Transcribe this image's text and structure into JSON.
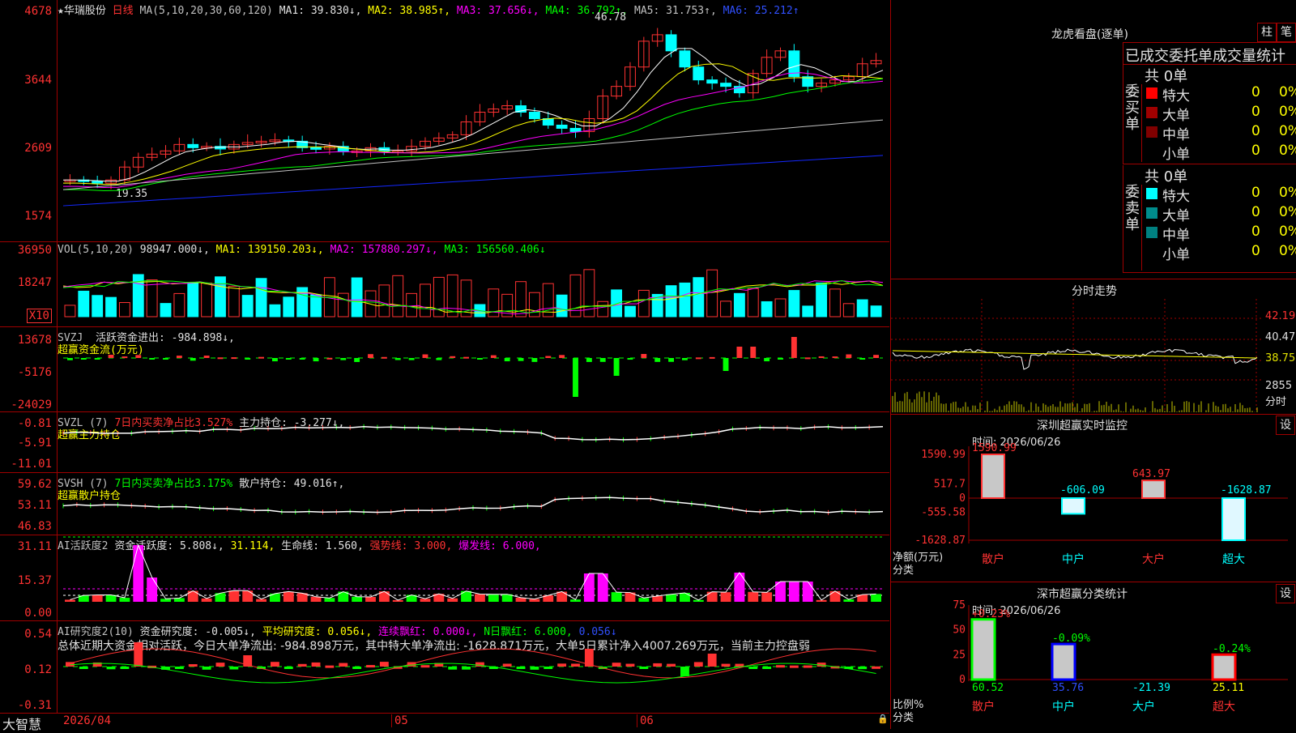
{
  "colors": {
    "up": "#ff3232",
    "down": "#00ffff",
    "ma1": "#ffffff",
    "ma2": "#ffff00",
    "ma3": "#ff00ff",
    "ma4": "#00ff00",
    "ma5": "#c0c0c0",
    "ma6": "#1428ff",
    "frame": "#a00000"
  },
  "price": {
    "yticks": [
      "4678",
      "3644",
      "2609",
      "1574"
    ],
    "star": "★",
    "stock": "华瑞股份",
    "period": "日线",
    "ma_label": "MA(5,10,20,30,60,120)",
    "ma1": "MA1: 39.830↓,",
    "ma2": "MA2: 38.985↑,",
    "ma3": "MA3: 37.656↓,",
    "ma4": "MA4: 36.792↑,",
    "ma5": "MA5: 31.753↑,",
    "ma6": "MA6: 25.212↑",
    "high_label": "46.78",
    "low_label": "19.35"
  },
  "vol": {
    "yticks": [
      "36950",
      "18247"
    ],
    "unit": "X10",
    "title": "VOL(5,10,20)",
    "v": "98947.000↓,",
    "ma1": "MA1: 139150.203↓,",
    "ma2": "MA2: 157880.297↓,",
    "ma3": "MA3: 156560.406↓"
  },
  "svzj": {
    "yticks": [
      "13678",
      "-5176",
      "-24029"
    ],
    "title": "SVZJ",
    "item": "活跃资金进出: -984.898↓,",
    "sub": "超赢资金流(万元)"
  },
  "svzl": {
    "yticks": [
      "-0.81",
      "-5.91",
      "-11.01"
    ],
    "title": "SVZL (7)",
    "ratio": "7日内买卖净占比3.527%",
    "hold": "主力持仓: -3.277↓,",
    "sub": "超赢主力持仓"
  },
  "svsh": {
    "yticks": [
      "59.62",
      "53.11",
      "46.83"
    ],
    "title": "SVSH (7)",
    "ratio": "7日内买卖净占比3.175%",
    "hold": "散户持仓: 49.016↑,",
    "sub": "超赢散户持仓"
  },
  "ai1": {
    "yticks": [
      "31.11",
      "15.37",
      "0.00"
    ],
    "title": "AI活跃度2",
    "act": "资金活跃度: 5.808↓,",
    "v2": "31.114,",
    "life": "生命线: 1.560,",
    "strong": "强势线: 3.000,",
    "burst": "爆发线: 6.000,"
  },
  "ai2": {
    "yticks": [
      "0.54",
      "0.12",
      "-0.31"
    ],
    "title": "AI研究度2(10)",
    "res": "资金研究度: -0.005↓,",
    "avg": "平均研究度: 0.056↓,",
    "lian": "连续飘红: 0.000↓,",
    "nday": "N日飘红: 6.000,",
    "last": "0.056↓",
    "summary": "总体近期大资金相对活跃，今日大单净流出: -984.898万元，其中特大单净流出: -1628.871万元，大单5日累计净入4007.269万元，当前主力控盘弱"
  },
  "xaxis": {
    "d1": "2026/04",
    "d2": "05",
    "d3": "06"
  },
  "brand": "大智慧",
  "right": {
    "lhb_title": "龙虎看盘(逐单)",
    "btn_zhu": "柱",
    "btn_bi": "笔",
    "tabs": [
      "已成交",
      "委托单",
      "成交量统计"
    ],
    "buy_label": "委买单",
    "sell_label": "委卖单",
    "buy_total": "共 0单",
    "sell_total": "共 0单",
    "buy_rows": [
      {
        "name": "特大",
        "v": "0",
        "p": "0%",
        "c": "#ff0000"
      },
      {
        "name": "大单",
        "v": "0",
        "p": "0%",
        "c": "#a00000"
      },
      {
        "name": "中单",
        "v": "0",
        "p": "0%",
        "c": "#800000"
      },
      {
        "name": "小单",
        "v": "0",
        "p": "0%",
        "c": ""
      }
    ],
    "sell_rows": [
      {
        "name": "特大",
        "v": "0",
        "p": "0%",
        "c": "#00ffff"
      },
      {
        "name": "大单",
        "v": "0",
        "p": "0%",
        "c": "#008c8c"
      },
      {
        "name": "中单",
        "v": "0",
        "p": "0%",
        "c": "#008080"
      },
      {
        "name": "小单",
        "v": "0",
        "p": "0%",
        "c": ""
      }
    ],
    "fs_title": "分时走势",
    "fs_ticks": [
      "42.19",
      "40.47",
      "38.75"
    ],
    "fs_vol": "2855",
    "fs_unit": "分时",
    "mon_title": "深圳超赢实时监控",
    "mon_time": "时间: 2026/06/26",
    "mon_set": "设",
    "mon_yticks": [
      "1590.99",
      "517.7",
      "0",
      "-555.58",
      "-1628.87"
    ],
    "mon_unit": "净额(万元)",
    "mon_cat": "分类",
    "mon_bars": [
      {
        "name": "散户",
        "v": 1590.99,
        "label": "1590.99"
      },
      {
        "name": "中户",
        "v": -606.09,
        "label": "-606.09"
      },
      {
        "name": "大户",
        "v": 643.97,
        "label": "643.97"
      },
      {
        "name": "超大",
        "v": -1628.87,
        "label": "-1628.87"
      }
    ],
    "cls_title": "深市超赢分类统计",
    "cls_time": "时间: 2026/06/26",
    "cls_set": "设",
    "cls_yticks": [
      "75",
      "50",
      "25",
      "0"
    ],
    "cls_unit": "比例%",
    "cls_cat": "分类",
    "cls_bars": [
      {
        "name": "散户",
        "v": 60.52,
        "pct": "+0.23%",
        "label": "60.52"
      },
      {
        "name": "中户",
        "v": 35.76,
        "pct": "-0.09%",
        "label": "35.76"
      },
      {
        "name": "大户",
        "v": -21.39,
        "pct": "",
        "label": "-21.39"
      },
      {
        "name": "超大",
        "v": 25.11,
        "pct": "-0.24%",
        "label": "25.11"
      }
    ]
  },
  "chart_data": {
    "type": "bar",
    "title": "",
    "categories": [
      "散户",
      "中户",
      "大户",
      "超大"
    ],
    "series": [
      {
        "name": "",
        "values": [
          1590.99,
          -606.09,
          643.97,
          -1628.87
        ]
      }
    ],
    "ylim": [
      -1628.87,
      1590.99
    ]
  }
}
